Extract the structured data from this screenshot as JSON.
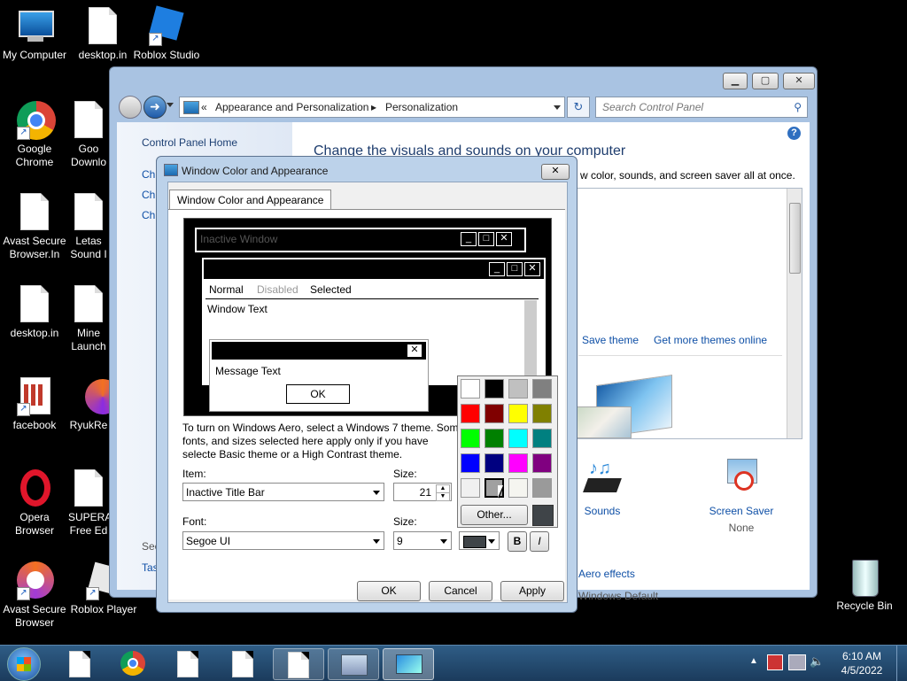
{
  "desktop": {
    "icons": [
      {
        "label": "My Computer"
      },
      {
        "label": "desktop.in"
      },
      {
        "label": "Roblox Studio"
      },
      {
        "label": "Google Chrome"
      },
      {
        "label": "Goo Downlo"
      },
      {
        "label": "Avast Secure Browser.In"
      },
      {
        "label": "Letas Sound I"
      },
      {
        "label": "desktop.in"
      },
      {
        "label": "Mine Launch"
      },
      {
        "label": "facebook"
      },
      {
        "label": "RyukRe"
      },
      {
        "label": "Opera Browser"
      },
      {
        "label": "SUPERA Free Ed"
      },
      {
        "label": "Avast Secure Browser"
      },
      {
        "label": "Roblox Player"
      },
      {
        "label": "Recycle Bin"
      }
    ]
  },
  "control_panel": {
    "breadcrumb_sep": "«",
    "breadcrumb": [
      "Appearance and Personalization",
      "Personalization"
    ],
    "search_placeholder": "Search Control Panel",
    "left_title": "Control Panel Home",
    "left_links_partial": [
      "Ch",
      "Ch",
      "Ch"
    ],
    "left_bottom_partial": [
      "See",
      "Tas"
    ],
    "heading": "Change the visuals and sounds on your computer",
    "subheading_partial": "w color, sounds, and screen saver all at once.",
    "save_theme": "Save theme",
    "get_more_themes": "Get more themes online",
    "sounds_label": "Sounds",
    "sounds_value": "Windows Default",
    "screensaver_label": "Screen Saver",
    "screensaver_value": "None",
    "aero_effects": "Aero effects"
  },
  "dialog": {
    "title": "Window Color and Appearance",
    "tab": "Window Color and Appearance",
    "preview": {
      "inactive_window": "Inactive Window",
      "menu": [
        "Normal",
        "Disabled",
        "Selected"
      ],
      "window_text": "Window Text",
      "message_text": "Message Text",
      "ok": "OK"
    },
    "info_text": "To turn on Windows Aero, select a Windows 7 theme. Som fonts, and sizes selected here apply only if you have selecte Basic theme or a High Contrast theme.",
    "item_label": "Item:",
    "item_value": "Inactive Title Bar",
    "size_label": "Size:",
    "size_value": "21",
    "font_label": "Font:",
    "font_value": "Segoe UI",
    "font_size_label": "Size:",
    "font_size_value": "9",
    "bold": "B",
    "italic": "I",
    "other_button": "Other...",
    "ok": "OK",
    "cancel": "Cancel",
    "apply": "Apply",
    "palette": [
      "#ffffff",
      "#000000",
      "#c0c0c0",
      "#808080",
      "#ff0000",
      "#800000",
      "#ffff00",
      "#808000",
      "#00ff00",
      "#008000",
      "#00ffff",
      "#008080",
      "#0000ff",
      "#000080",
      "#ff00ff",
      "#800080",
      "#f0f0f0",
      "#a0a0a0",
      "#f5f5f0",
      "#9a9a9a"
    ],
    "selected_color": "#3f4448"
  },
  "taskbar": {
    "time": "6:10 AM",
    "date": "4/5/2022"
  }
}
